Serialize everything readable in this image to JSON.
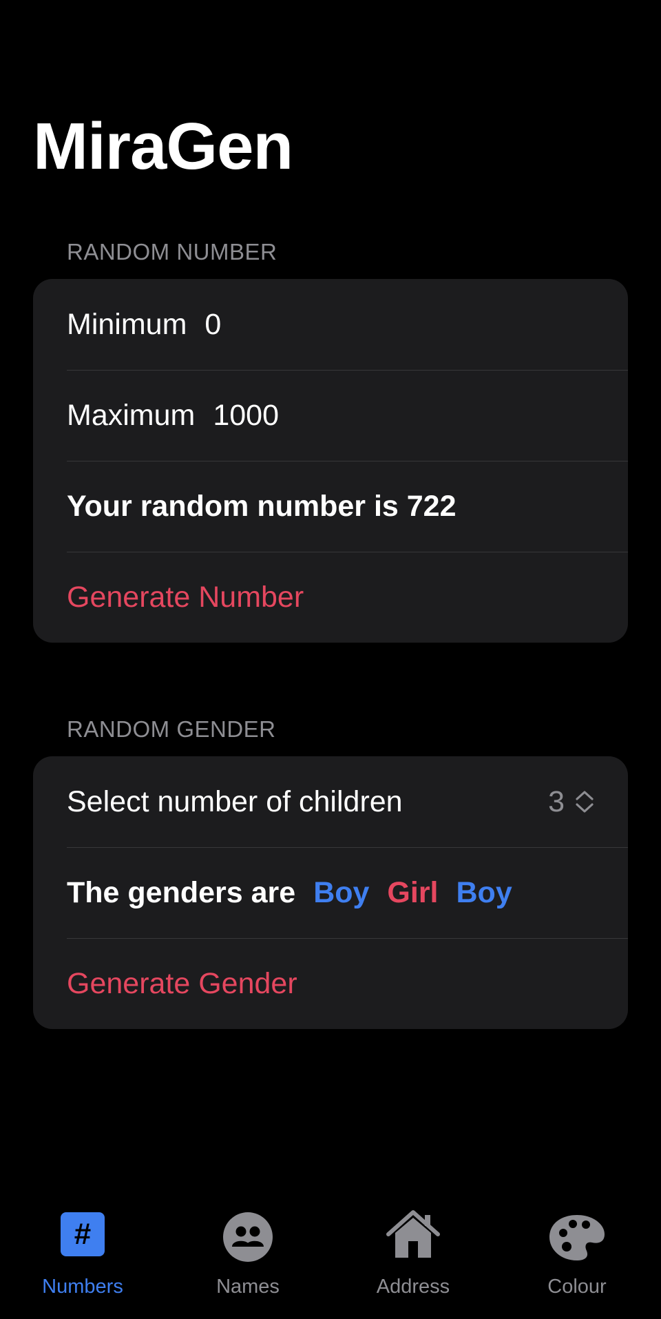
{
  "app": {
    "title": "MiraGen"
  },
  "number_section": {
    "header": "RANDOM NUMBER",
    "minimum_label": "Minimum",
    "minimum_value": "0",
    "maximum_label": "Maximum",
    "maximum_value": "1000",
    "result_text": "Your random number is 722",
    "generate_label": "Generate Number"
  },
  "gender_section": {
    "header": "RANDOM GENDER",
    "children_label": "Select number of children",
    "children_value": "3",
    "result_prefix": "The genders are",
    "genders": [
      "Boy",
      "Girl",
      "Boy"
    ],
    "generate_label": "Generate Gender"
  },
  "tabs": [
    {
      "label": "Numbers",
      "icon": "hash-icon",
      "active": true
    },
    {
      "label": "Names",
      "icon": "people-icon",
      "active": false
    },
    {
      "label": "Address",
      "icon": "house-icon",
      "active": false
    },
    {
      "label": "Colour",
      "icon": "palette-icon",
      "active": false
    }
  ],
  "colors": {
    "accent_blue": "#3f7ff0",
    "accent_red": "#e5475f",
    "card_bg": "#1c1c1e",
    "secondary_text": "#8e8e93"
  }
}
